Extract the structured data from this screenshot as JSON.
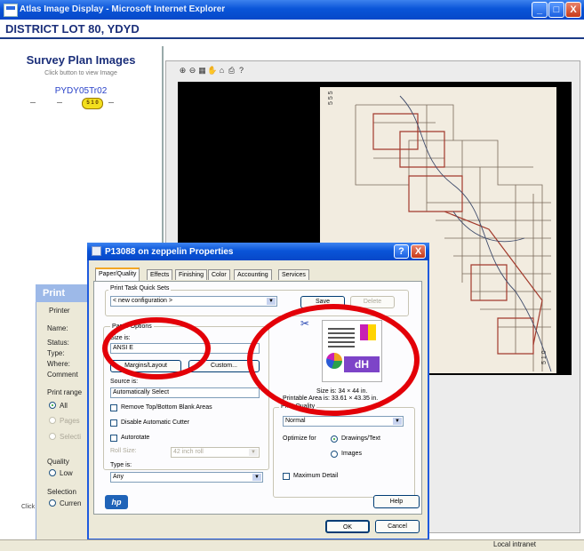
{
  "browser": {
    "title": "Atlas Image Display - Microsoft Internet Explorer",
    "minimize": "_",
    "maximize": "□",
    "close": "X",
    "status": "Local intranet"
  },
  "page": {
    "heading": "DISTRICT LOT 80, YDYD",
    "survey_title": "Survey Plan Images",
    "survey_hint": "Click button to view Image",
    "plan_code": "PYDY05Tr02",
    "plan_badge": "5 1 0",
    "viewer_tools": [
      "⊕",
      "⊖",
      "▦",
      "✋",
      "⌂",
      "⎙",
      "?"
    ]
  },
  "print_dialog": {
    "title": "Print",
    "printer_group": "Printer",
    "name_label": "Name:",
    "status_label": "Status:",
    "type_label": "Type:",
    "where_label": "Where:",
    "comment_label": "Comment",
    "print_range": "Print range",
    "all": "All",
    "pages": "Pages",
    "selection": "Selecti",
    "quality": "Quality",
    "low": "Low",
    "selection_group": "Selection",
    "current": "Curren",
    "click_hint": "Click"
  },
  "props": {
    "title": "P13088 on zeppelin Properties",
    "help_btn": "?",
    "close_btn": "X",
    "tabs": [
      "Paper/Quality",
      "Effects",
      "Finishing",
      "Color",
      "Accounting",
      "Services"
    ],
    "quick_sets_label": "Print Task Quick Sets",
    "quick_sets_value": "< new configuration >",
    "save": "Save",
    "delete": "Delete",
    "paper_options": "Paper Options",
    "size_is": "Size is:",
    "size_value": "ANSI E",
    "margins_btn": "Margins/Layout",
    "custom_btn": "Custom...",
    "source_is": "Source is:",
    "source_value": "Automatically Select",
    "remove_blank": "Remove Top/Bottom Blank Areas",
    "disable_cutter": "Disable Automatic Cutter",
    "autorotate": "Autorotate",
    "roll_size": "Roll Size:",
    "roll_value": "42 inch roll",
    "type_is": "Type is:",
    "type_value": "Any",
    "size_info": "Size is:  34 × 44 in.",
    "printable_info": "Printable Area is:  33.61 × 43.35 in.",
    "print_quality": "Print Quality",
    "quality_value": "Normal",
    "optimize_for": "Optimize for",
    "drawings_text": "Drawings/Text",
    "images": "Images",
    "max_detail": "Maximum Detail",
    "help": "Help",
    "ok": "OK",
    "cancel": "Cancel",
    "preview_label": "dH",
    "logo_text": "hp"
  },
  "colors": {
    "title_bar": "#0a55d8",
    "dialog_bg": "#ece9d8",
    "heading": "#1b2f7a",
    "annotation_ring": "#e30008",
    "badge": "#f3df1e"
  }
}
